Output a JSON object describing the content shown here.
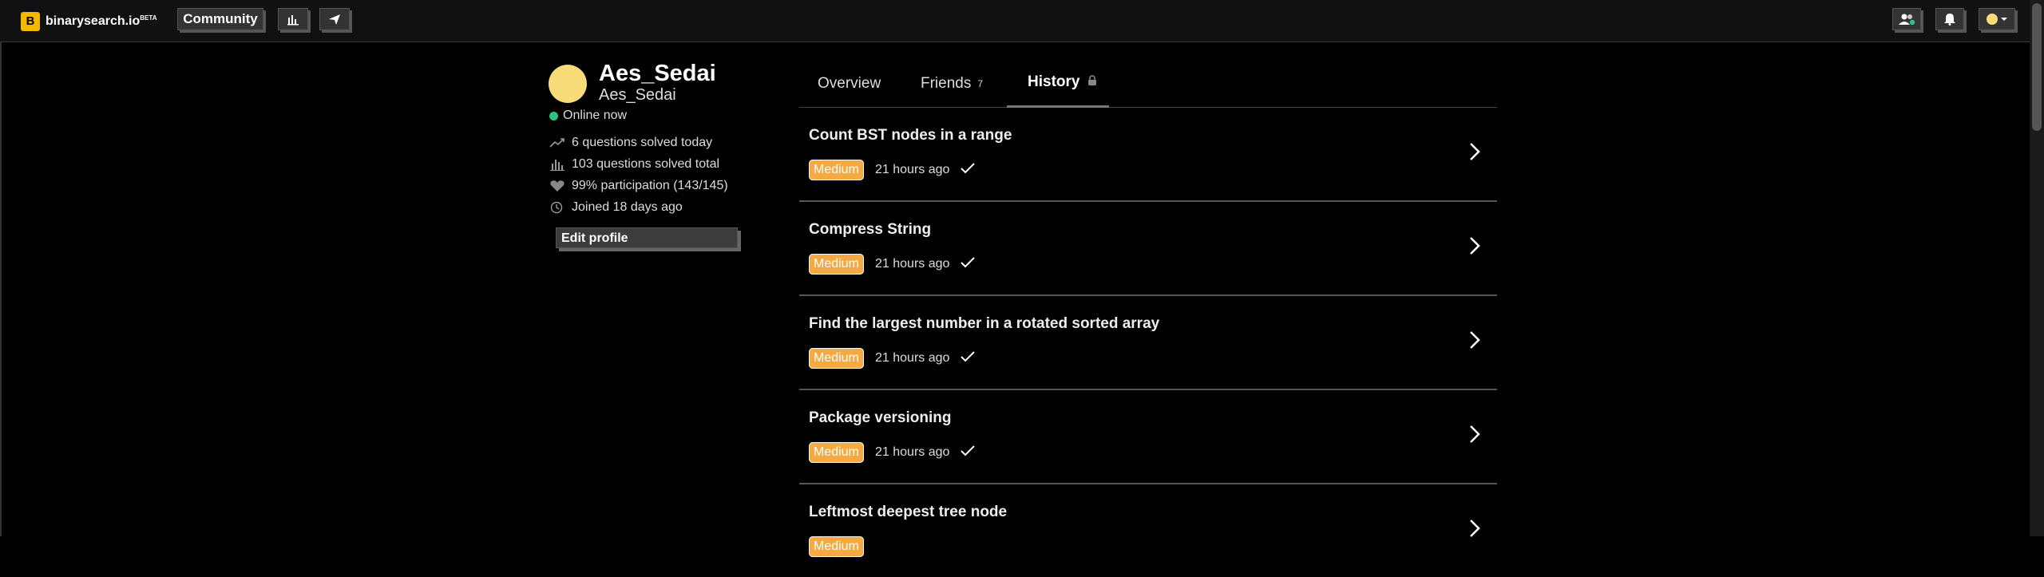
{
  "topbar": {
    "logo_letter": "B",
    "logo_text": "binarysearch.io",
    "logo_beta": "BETA",
    "community_label": "Community",
    "icons": [
      "bar-chart-icon",
      "send-icon",
      "friends-icon",
      "bell-icon",
      "avatar-dropdown-icon"
    ]
  },
  "profile": {
    "display_name": "Aes_Sedai",
    "username": "Aes_Sedai",
    "status": "Online now",
    "stats": [
      {
        "icon": "trend-icon",
        "text": "6 questions solved today"
      },
      {
        "icon": "bar-chart-icon",
        "text": "103 questions solved total"
      },
      {
        "icon": "heart-icon",
        "text": "99% participation (143/145)"
      },
      {
        "icon": "clock-icon",
        "text": "Joined 18 days ago"
      }
    ],
    "edit_label": "Edit profile",
    "avatar_color": "#f9dc7a",
    "online_color": "#2ec27e"
  },
  "tabs": {
    "overview": "Overview",
    "friends": "Friends",
    "friends_count": "7",
    "history": "History"
  },
  "history": [
    {
      "title": "Count BST nodes in a range",
      "difficulty": "Medium",
      "time": "21 hours ago"
    },
    {
      "title": "Compress String",
      "difficulty": "Medium",
      "time": "21 hours ago"
    },
    {
      "title": "Find the largest number in a rotated sorted array",
      "difficulty": "Medium",
      "time": "21 hours ago"
    },
    {
      "title": "Package versioning",
      "difficulty": "Medium",
      "time": "21 hours ago"
    },
    {
      "title": "Leftmost deepest tree node",
      "difficulty": "Medium",
      "time": ""
    }
  ],
  "colors": {
    "medium_badge": "#f5a942",
    "brand": "#f5b800"
  }
}
